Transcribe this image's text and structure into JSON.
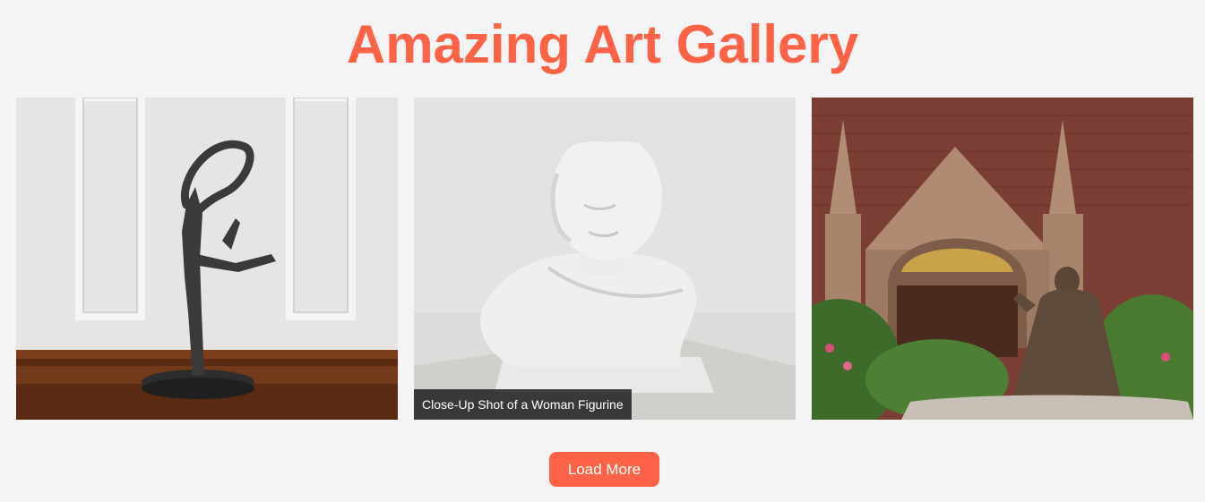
{
  "page": {
    "title": "Amazing Art Gallery",
    "accent_color": "#ff6347",
    "background_color": "#f4f4f4"
  },
  "gallery": {
    "items": [
      {
        "subject": "abstract-dancer-sculpture",
        "caption": ""
      },
      {
        "subject": "white-bust-figurine",
        "caption": "Close-Up Shot of a Woman Figurine"
      },
      {
        "subject": "church-facade-with-statue",
        "caption": ""
      }
    ]
  },
  "actions": {
    "load_more_label": "Load More"
  }
}
